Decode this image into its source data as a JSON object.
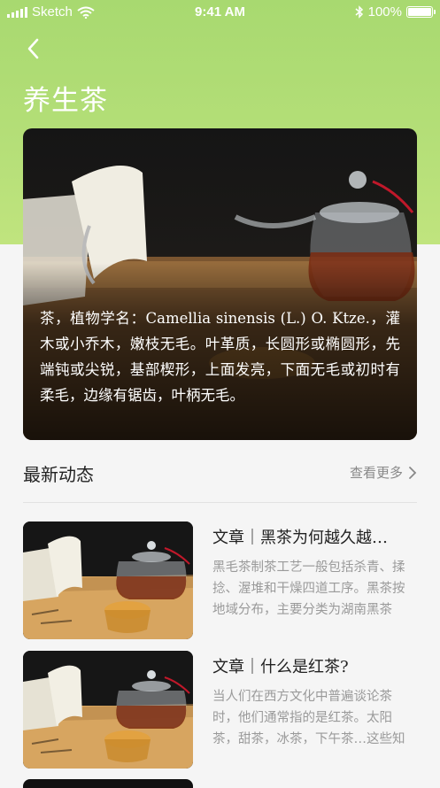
{
  "status_bar": {
    "carrier": "Sketch",
    "time": "9:41 AM",
    "battery": "100%"
  },
  "header": {
    "title": "养生茶"
  },
  "hero": {
    "description": "茶，植物学名：Camellia sinensis (L.) O. Ktze.，灌木或小乔木，嫩枝无毛。叶革质，长圆形或椭圆形，先端钝或尖锐，基部楔形，上面发亮，下面无毛或初时有柔毛，边缘有锯齿，叶柄无毛。"
  },
  "section": {
    "title": "最新动态",
    "more_label": "查看更多"
  },
  "articles": [
    {
      "title": "文章｜黑茶为何越久越…",
      "desc": "黑毛茶制茶工艺一般包括杀青、揉捻、渥堆和干燥四道工序。黑茶按地域分布，主要分类为湖南黑茶（茯茶、千两茶…"
    },
    {
      "title": "文章｜什么是红茶?",
      "desc": "当人们在西方文化中普遍谈论茶时，他们通常指的是红茶。太阳茶，甜茶，冰茶，下午茶…这些知名的茶类通常使用红茶制成…"
    }
  ],
  "colors": {
    "header_green": "#b5df78",
    "background": "#f5f5f5"
  },
  "icons": [
    "back-arrow-icon",
    "chevron-right-icon",
    "wifi-icon",
    "bluetooth-icon",
    "battery-icon",
    "signal-icon"
  ]
}
